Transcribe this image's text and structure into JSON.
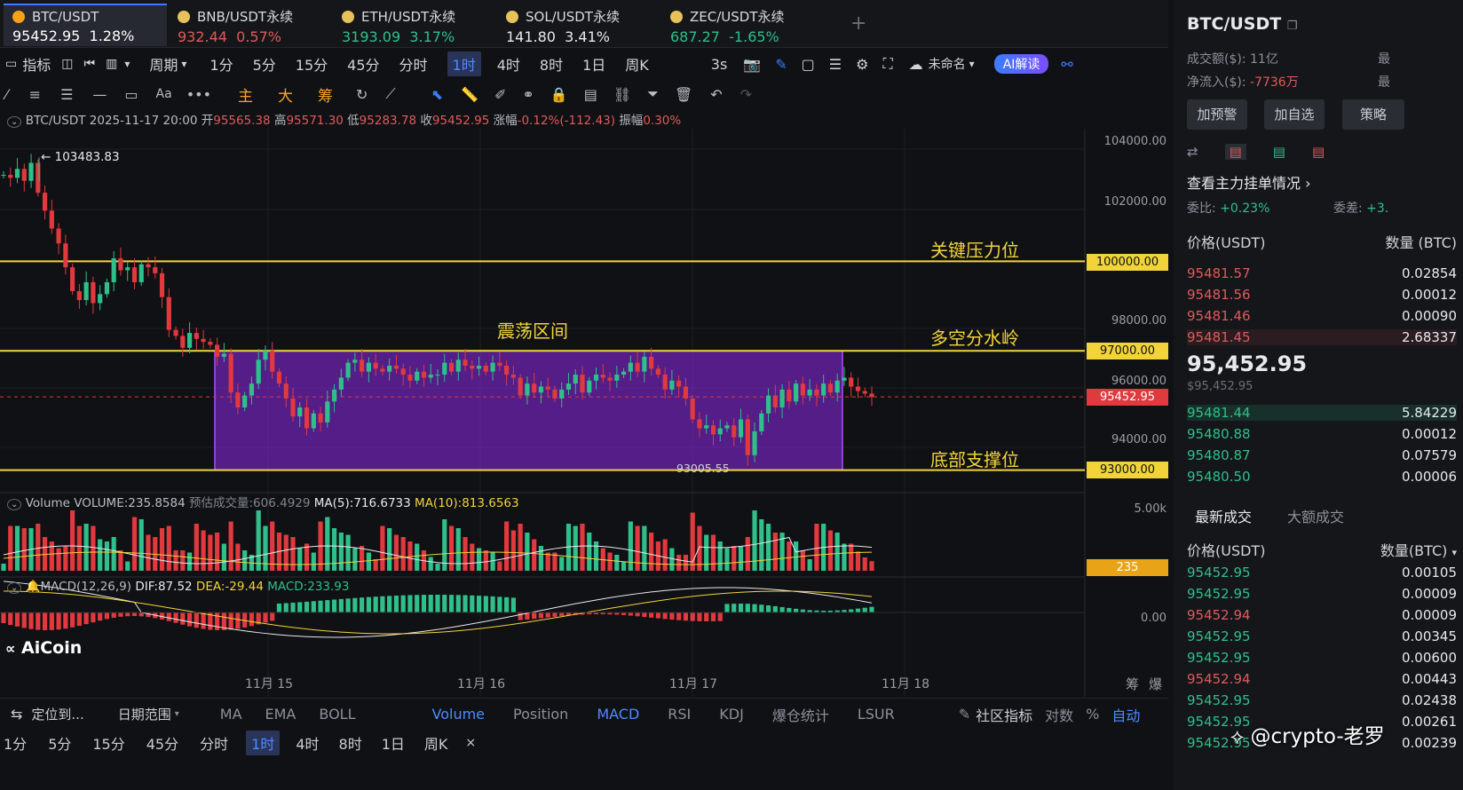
{
  "tabs": [
    {
      "pair": "BTC/USDT",
      "price": "95452.95",
      "change": "1.28%",
      "dir": "white",
      "active": true
    },
    {
      "pair": "BNB/USDT永续",
      "price": "932.44",
      "change": "0.57%",
      "dir": "red"
    },
    {
      "pair": "ETH/USDT永续",
      "price": "3193.09",
      "change": "3.17%",
      "dir": "green"
    },
    {
      "pair": "SOL/USDT永续",
      "price": "141.80",
      "change": "3.41%",
      "dir": "white"
    },
    {
      "pair": "ZEC/USDT永续",
      "price": "687.27",
      "change": "-1.65%",
      "dir": "green"
    }
  ],
  "toolbar": {
    "indicators": "指标",
    "period": "周期",
    "timeframes": [
      "1分",
      "5分",
      "15分",
      "45分",
      "分时",
      "1时",
      "4时",
      "8时",
      "1日",
      "周K"
    ],
    "active_tf": "1时",
    "refresh": "3s",
    "layout": "未命名",
    "ai": "AI解读"
  },
  "draw_tools": {
    "labels": [
      "主",
      "大",
      "筹"
    ]
  },
  "ohlc": {
    "pair": "BTC/USDT",
    "datetime": "2025-11-17 20:00",
    "open_l": "开",
    "open": "95565.38",
    "high_l": "高",
    "high": "95571.30",
    "low_l": "低",
    "low": "95283.78",
    "close_l": "收",
    "close": "95452.95",
    "chg_l": "涨幅",
    "chg": "-0.12%(-112.43)",
    "amp_l": "振幅",
    "amp": "0.30%"
  },
  "price_axis": [
    "104000.00",
    "102000.00",
    "98000.00",
    "96000.00",
    "94000.00"
  ],
  "levels": [
    {
      "price": "100000.00",
      "label": "关键压力位"
    },
    {
      "price": "97000.00",
      "label": "多空分水岭"
    },
    {
      "price": "93000.00",
      "label": "底部支撑位"
    }
  ],
  "current_price": "95452.95",
  "range_label": "震荡区间",
  "high_marker": "← 103483.83",
  "low_marker": "93005.55",
  "volume": {
    "title": "Volume",
    "value": "VOLUME:235.8584",
    "est": "预估成交量:606.4929",
    "ma5": "MA(5):716.6733",
    "ma10": "MA(10):813.6563",
    "axis": "5.00k",
    "current": "235"
  },
  "macd": {
    "title": "MACD(12,26,9)",
    "dif": "DIF:87.52",
    "dea": "DEA:-29.44",
    "macd": "MACD:233.93",
    "axis": "0.00"
  },
  "logo": "AiCoin",
  "x_axis": [
    "11月 15",
    "11月 16",
    "11月 17",
    "11月 18"
  ],
  "x_axis_right": [
    "筹",
    "爆"
  ],
  "bottom": {
    "locate": "定位到...",
    "range": "日期范围",
    "indicators": [
      "MA",
      "EMA",
      "BOLL",
      "Volume",
      "Position",
      "MACD",
      "RSI",
      "KDJ",
      "爆仓统计",
      "LSUR"
    ],
    "community": "社区指标",
    "log": "对数",
    "pct": "%",
    "auto": "自动",
    "timeframes": [
      "1分",
      "5分",
      "15分",
      "45分",
      "分时",
      "1时",
      "4时",
      "8时",
      "1日",
      "周K"
    ]
  },
  "side": {
    "pair": "BTC/USDT",
    "turnover_l": "成交额($):",
    "turnover": "11亿",
    "netflow_l": "净流入($):",
    "netflow": "-7736万",
    "buttons": [
      "加预警",
      "加自选",
      "策略"
    ],
    "orders_link": "查看主力挂单情况",
    "ratio_l": "委比:",
    "ratio": "+0.23%",
    "diff_l": "委差:",
    "diff": "+3.",
    "col_price": "价格(USDT)",
    "col_qty": "数量 (BTC)",
    "asks": [
      [
        "95481.57",
        "0.02854"
      ],
      [
        "95481.56",
        "0.00012"
      ],
      [
        "95481.46",
        "0.00090"
      ],
      [
        "95481.45",
        "2.68337"
      ]
    ],
    "last": "95,452.95",
    "last_usd": "$95,452.95",
    "bids": [
      [
        "95481.44",
        "5.84229"
      ],
      [
        "95480.88",
        "0.00012"
      ],
      [
        "95480.87",
        "0.07579"
      ],
      [
        "95480.50",
        "0.00006"
      ]
    ],
    "trades_tab1": "最新成交",
    "trades_tab2": "大额成交",
    "tcol_price": "价格(USDT)",
    "tcol_qty": "数量(BTC)",
    "trades": [
      [
        "95452.95",
        "0.00105",
        "g"
      ],
      [
        "95452.95",
        "0.00009",
        "g"
      ],
      [
        "95452.94",
        "0.00009",
        "r"
      ],
      [
        "95452.95",
        "0.00345",
        "g"
      ],
      [
        "95452.95",
        "0.00600",
        "g"
      ],
      [
        "95452.94",
        "0.00443",
        "r"
      ],
      [
        "95452.95",
        "0.02438",
        "g"
      ],
      [
        "95452.95",
        "0.00261",
        "g"
      ],
      [
        "95452.95",
        "0.00239",
        "g"
      ]
    ],
    "watermark": "@crypto-老罗"
  }
}
